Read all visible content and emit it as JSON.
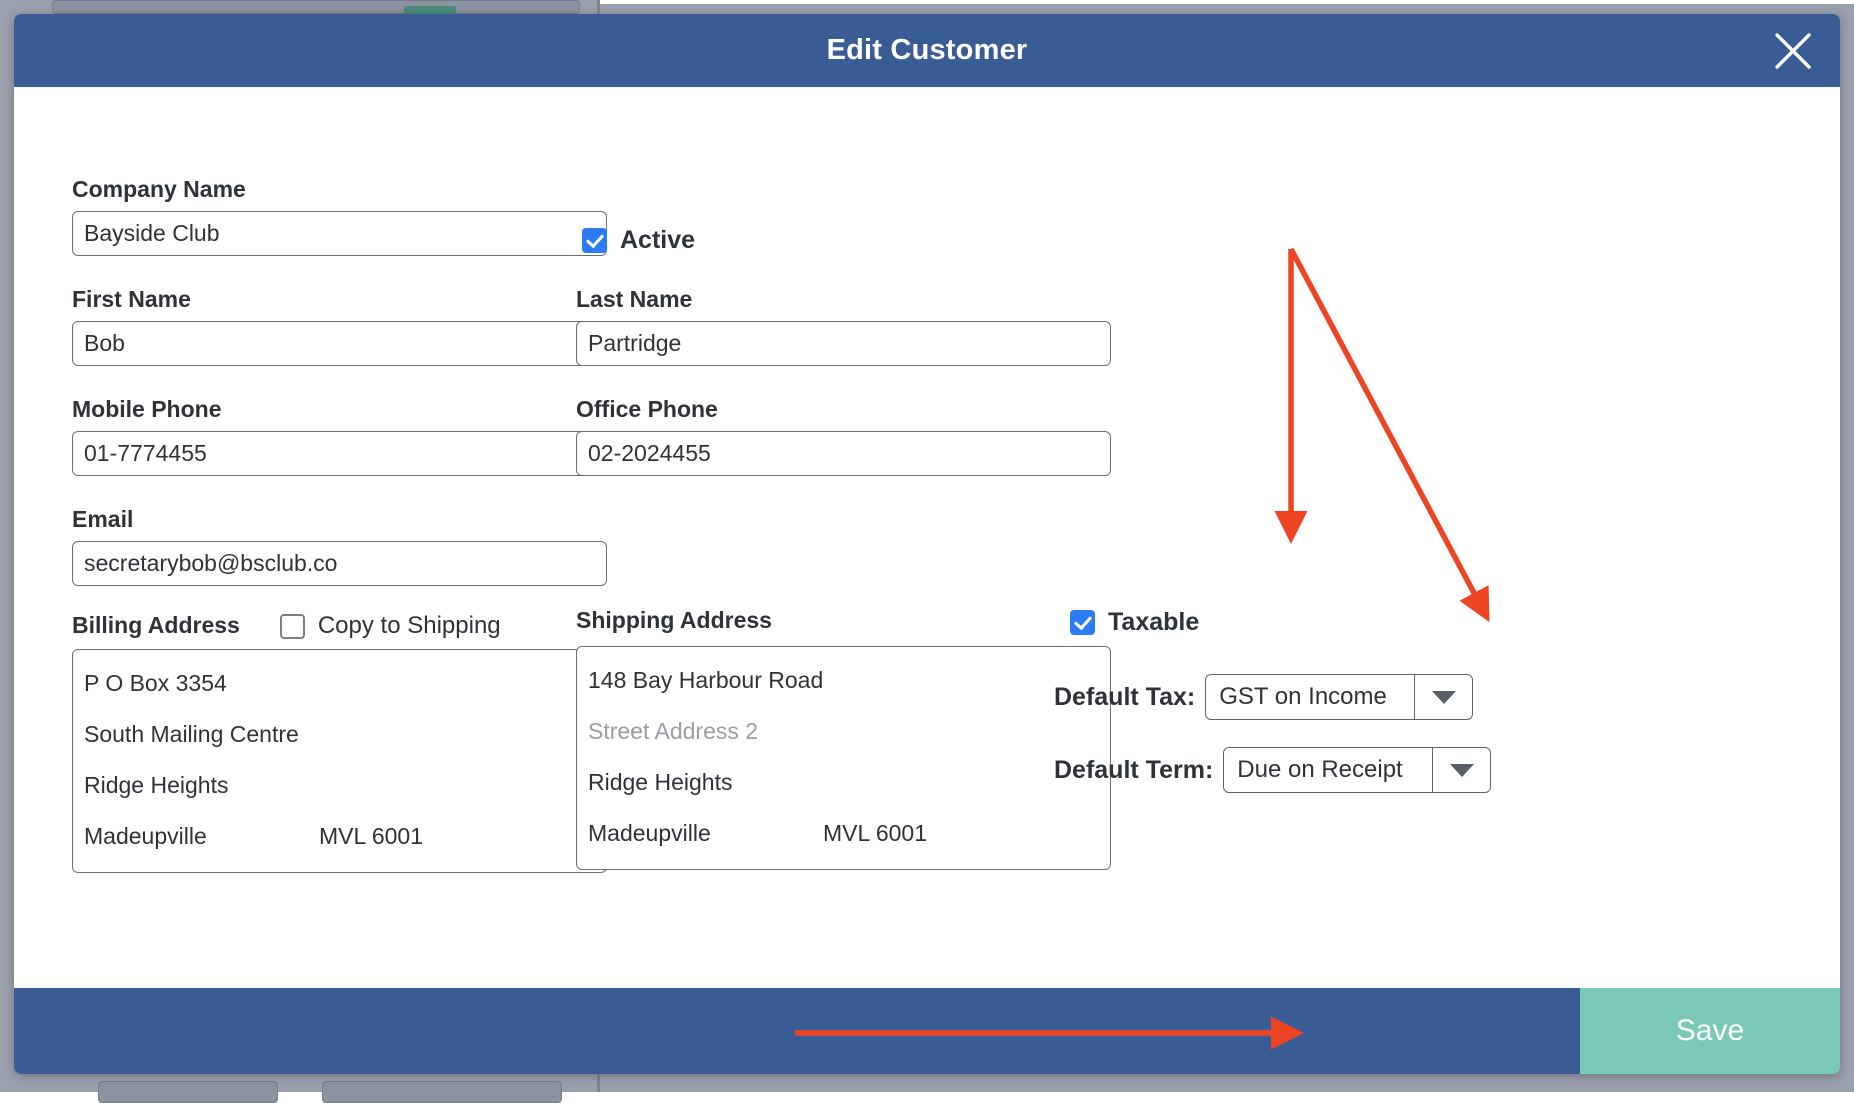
{
  "modal": {
    "title": "Edit Customer",
    "close_icon": "close-icon"
  },
  "form": {
    "company_name": {
      "label": "Company Name",
      "value": "Bayside Club",
      "placeholder": "Company Name"
    },
    "active": {
      "label": "Active",
      "checked": true
    },
    "first_name": {
      "label": "First Name",
      "value": "Bob",
      "placeholder": "First Name"
    },
    "last_name": {
      "label": "Last Name",
      "value": "Partridge",
      "placeholder": "Last Name"
    },
    "mobile_phone": {
      "label": "Mobile Phone",
      "value": "01-7774455",
      "placeholder": "Mobile Phone"
    },
    "office_phone": {
      "label": "Office Phone",
      "value": "02-2024455",
      "placeholder": "Office Phone"
    },
    "email": {
      "label": "Email",
      "value": "secretarybob@bsclub.co",
      "placeholder": "Email"
    },
    "billing_address": {
      "label": "Billing Address",
      "line1": "P O Box 3354",
      "line2": "South Mailing Centre",
      "line3": "Ridge Heights",
      "city": "Madeupville",
      "postcode": "MVL 6001"
    },
    "copy_to_shipping": {
      "label": "Copy to Shipping",
      "checked": false
    },
    "shipping_address": {
      "label": "Shipping Address",
      "line1": "148 Bay Harbour Road",
      "line2_placeholder": "Street Address 2",
      "line2": "",
      "line3": "Ridge Heights",
      "city": "Madeupville",
      "postcode": "MVL 6001"
    },
    "taxable": {
      "label": "Taxable",
      "checked": true
    },
    "default_tax": {
      "label": "Default Tax:",
      "value": "GST on Income",
      "caret_icon": "chevron-down-icon"
    },
    "default_term": {
      "label": "Default Term:",
      "value": "Due on Receipt",
      "caret_icon": "chevron-down-icon"
    }
  },
  "footer": {
    "save_label": "Save"
  },
  "annotations": {
    "arrow_taxable": "arrow-pointing-to-taxable-checkbox",
    "arrow_default_tax": "arrow-pointing-to-default-tax-dropdown",
    "arrow_save": "arrow-pointing-to-save-button"
  },
  "colors": {
    "header_blue": "#3a5c94",
    "save_teal": "#79c9b6",
    "checkbox_blue": "#2b7cf5",
    "annotation_red": "#ef4423",
    "backdrop_gray": "#9aa0ac"
  }
}
